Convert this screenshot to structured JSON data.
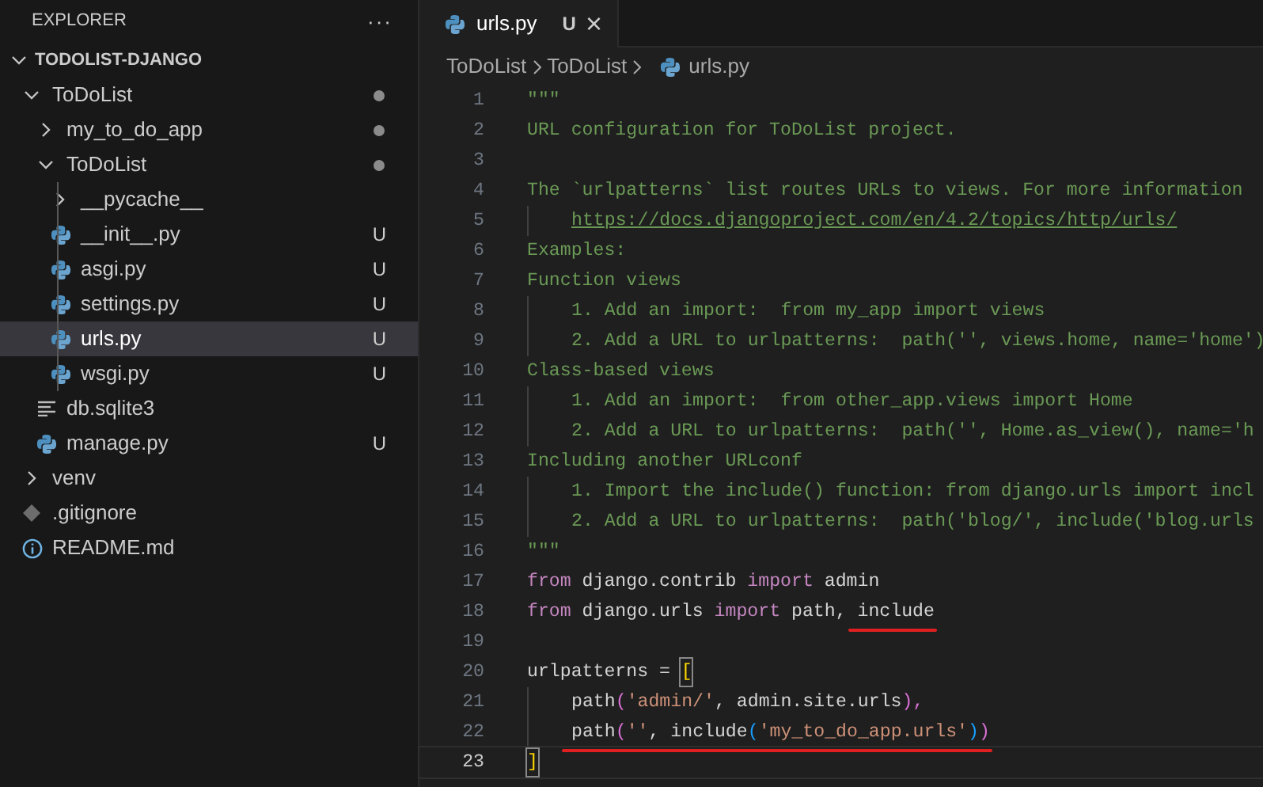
{
  "sidebar": {
    "title": "EXPLORER",
    "more": "···",
    "workspace": {
      "label": "TODOLIST-DJANGO",
      "expanded": true,
      "children": [
        {
          "label": "ToDoList",
          "kind": "folder",
          "expanded": true,
          "modified": true,
          "selected": false,
          "children": [
            {
              "label": "my_to_do_app",
              "kind": "folder",
              "expanded": false,
              "modified": true,
              "selected": false
            },
            {
              "label": "ToDoList",
              "kind": "folder",
              "expanded": true,
              "modified": true,
              "selected": false,
              "children": [
                {
                  "label": "__pycache__",
                  "kind": "folder",
                  "expanded": false,
                  "selected": false
                },
                {
                  "label": "__init__.py",
                  "kind": "python",
                  "badge": "U",
                  "selected": false
                },
                {
                  "label": "asgi.py",
                  "kind": "python",
                  "badge": "U",
                  "selected": false
                },
                {
                  "label": "settings.py",
                  "kind": "python",
                  "badge": "U",
                  "selected": false
                },
                {
                  "label": "urls.py",
                  "kind": "python",
                  "badge": "U",
                  "selected": true
                },
                {
                  "label": "wsgi.py",
                  "kind": "python",
                  "badge": "U",
                  "selected": false
                }
              ]
            },
            {
              "label": "db.sqlite3",
              "kind": "text",
              "selected": false
            },
            {
              "label": "manage.py",
              "kind": "python",
              "badge": "U",
              "selected": false
            }
          ]
        },
        {
          "label": "venv",
          "kind": "folder",
          "expanded": false,
          "selected": false
        },
        {
          "label": ".gitignore",
          "kind": "git",
          "selected": false
        },
        {
          "label": "README.md",
          "kind": "info",
          "selected": false
        }
      ]
    }
  },
  "tabs": [
    {
      "label": "urls.py",
      "badge": "U",
      "close": "×",
      "selected": true
    }
  ],
  "breadcrumb": [
    {
      "label": "ToDoList",
      "kind": "folder"
    },
    {
      "label": "ToDoList",
      "kind": "folder"
    },
    {
      "label": "urls.py",
      "kind": "python"
    }
  ],
  "editor": {
    "lines": [
      {
        "number": "1",
        "indent": false,
        "current": false,
        "tokens": [
          {
            "text": "\"\"\"",
            "kind": "doc"
          }
        ]
      },
      {
        "number": "2",
        "indent": false,
        "current": false,
        "tokens": [
          {
            "text": "URL configuration for ToDoList project.",
            "kind": "doc"
          }
        ]
      },
      {
        "number": "3",
        "indent": false,
        "current": false
      },
      {
        "number": "4",
        "indent": false,
        "current": false,
        "tokens": [
          {
            "text": "The `urlpatterns` list routes URLs to views. For more information",
            "kind": "doc"
          }
        ]
      },
      {
        "number": "5",
        "indent": true,
        "current": false,
        "tokens": [
          {
            "text": "https://docs.djangoproject.com/en/4.2/topics/http/urls/",
            "kind": "link"
          }
        ]
      },
      {
        "number": "6",
        "indent": false,
        "current": false,
        "tokens": [
          {
            "text": "Examples:",
            "kind": "doc"
          }
        ]
      },
      {
        "number": "7",
        "indent": false,
        "current": false,
        "tokens": [
          {
            "text": "Function views",
            "kind": "doc"
          }
        ]
      },
      {
        "number": "8",
        "indent": true,
        "current": false,
        "tokens": [
          {
            "text": "1. Add an import:  from my_app import views",
            "kind": "doc"
          }
        ]
      },
      {
        "number": "9",
        "indent": true,
        "current": false,
        "tokens": [
          {
            "text": "2. Add a URL to urlpatterns:  path('', views.home, name='home')",
            "kind": "doc"
          }
        ]
      },
      {
        "number": "10",
        "indent": false,
        "current": false,
        "tokens": [
          {
            "text": "Class-based views",
            "kind": "doc"
          }
        ]
      },
      {
        "number": "11",
        "indent": true,
        "current": false,
        "tokens": [
          {
            "text": "1. Add an import:  from other_app.views import Home",
            "kind": "doc"
          }
        ]
      },
      {
        "number": "12",
        "indent": true,
        "current": false,
        "tokens": [
          {
            "text": "2. Add a URL to urlpatterns:  path('', Home.as_view(), name='h",
            "kind": "doc"
          }
        ]
      },
      {
        "number": "13",
        "indent": false,
        "current": false,
        "tokens": [
          {
            "text": "Including another URLconf",
            "kind": "doc"
          }
        ]
      },
      {
        "number": "14",
        "indent": true,
        "current": false,
        "tokens": [
          {
            "text": "1. Import the include() function: from django.urls import incl",
            "kind": "doc"
          }
        ]
      },
      {
        "number": "15",
        "indent": true,
        "current": false,
        "tokens": [
          {
            "text": "2. Add a URL to urlpatterns:  path('blog/', include('blog.urls",
            "kind": "doc"
          }
        ]
      },
      {
        "number": "16",
        "indent": false,
        "current": false,
        "tokens": [
          {
            "text": "\"\"\"",
            "kind": "doc"
          }
        ]
      },
      {
        "number": "17",
        "indent": false,
        "current": false,
        "tokens": [
          {
            "text": "from",
            "kind": "keyword"
          },
          {
            "text": " django.contrib ",
            "kind": "plain"
          },
          {
            "text": "import",
            "kind": "keyword"
          },
          {
            "text": " admin",
            "kind": "plain"
          }
        ]
      },
      {
        "number": "18",
        "indent": false,
        "current": false,
        "tokens": [
          {
            "text": "from",
            "kind": "keyword"
          },
          {
            "text": " django.urls ",
            "kind": "plain"
          },
          {
            "text": "import",
            "kind": "keyword"
          },
          {
            "text": " path, ",
            "kind": "plain"
          },
          {
            "text": "include",
            "kind": "plain",
            "marked": true
          }
        ]
      },
      {
        "number": "19",
        "indent": false,
        "current": false
      },
      {
        "number": "20",
        "indent": false,
        "current": false,
        "tokens": [
          {
            "text": "urlpatterns = ",
            "kind": "plain"
          },
          {
            "text": "[",
            "kind": "bracket1",
            "matched": true
          }
        ]
      },
      {
        "number": "21",
        "indent": true,
        "current": false,
        "tokens": [
          {
            "text": "path",
            "kind": "plain"
          },
          {
            "text": "(",
            "kind": "bracket2"
          },
          {
            "text": "'admin/'",
            "kind": "string"
          },
          {
            "text": ", admin.site.urls",
            "kind": "plain"
          },
          {
            "text": "),",
            "kind": "bracket2"
          }
        ]
      },
      {
        "number": "22",
        "indent": true,
        "current": false,
        "tokens": [
          {
            "text": "path",
            "kind": "plain",
            "marked": true
          },
          {
            "text": "(",
            "kind": "bracket2",
            "marked": true
          },
          {
            "text": "''",
            "kind": "string",
            "marked": true
          },
          {
            "text": ", include",
            "kind": "plain",
            "marked": true
          },
          {
            "text": "(",
            "kind": "bracket3",
            "marked": true
          },
          {
            "text": "'my_to_do_app.urls'",
            "kind": "string",
            "marked": true
          },
          {
            "text": ")",
            "kind": "bracket3",
            "marked": true
          },
          {
            "text": ")",
            "kind": "bracket2",
            "marked": true
          }
        ]
      },
      {
        "number": "23",
        "indent": false,
        "current": true,
        "tokens": [
          {
            "text": "]",
            "kind": "bracket1",
            "matched": true
          }
        ]
      }
    ]
  }
}
